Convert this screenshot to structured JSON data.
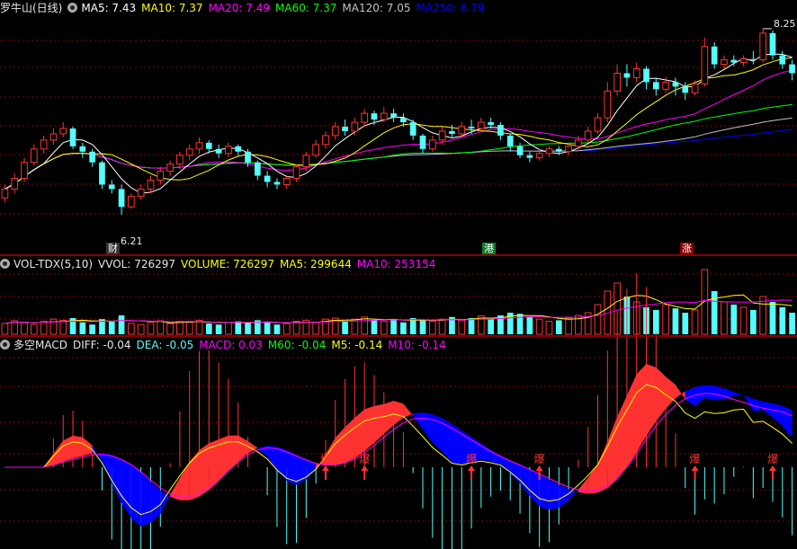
{
  "main_header": {
    "stock_name": "罗牛山(日线)",
    "ma5": "MA5: 7.43",
    "ma10": "MA10: 7.37",
    "ma20": "MA20: 7.49",
    "ma60": "MA60: 7.37",
    "ma120": "MA120: 7.05",
    "ma250": "MA250: 6.79"
  },
  "price_labels": {
    "high": "8.25",
    "low": "6.21"
  },
  "event_tags": {
    "cai": "财",
    "gang": "港",
    "zhang": "涨"
  },
  "volume_header": {
    "indicator": "VOL-TDX(5,10)",
    "vvol": "VVOL: 726297",
    "volume": "VOLUME: 726297",
    "ma5": "MA5: 299644",
    "ma10": "MA10: 253154"
  },
  "macd_header": {
    "indicator": "多空MACD",
    "diff": "DIFF: -0.04",
    "dea": "DEA: -0.05",
    "macd": "MACD: 0.03",
    "m60": "M60: -0.04",
    "m5": "M5: -0.14",
    "m10": "M10: -0.14"
  },
  "signal_label": "爆",
  "colors": {
    "background": "#000000",
    "up": "#ff3232",
    "down": "#54fcfc",
    "ma5": "#ffffff",
    "ma10": "#ffff00",
    "ma20": "#ff00ff",
    "ma60": "#00ff00",
    "ma120": "#c0c0c0",
    "ma250": "#0000ff",
    "grid": "#8b0000"
  },
  "chart_data": {
    "type": "candlestick",
    "price_scale": {
      "min": 6.0,
      "max": 8.4
    },
    "candles": [
      [
        6.4,
        6.5,
        6.35,
        6.55
      ],
      [
        6.5,
        6.62,
        6.45,
        6.68
      ],
      [
        6.62,
        6.8,
        6.58,
        6.85
      ],
      [
        6.8,
        6.95,
        6.76,
        7.0
      ],
      [
        6.95,
        7.05,
        6.9,
        7.1
      ],
      [
        7.05,
        7.12,
        7.0,
        7.18
      ],
      [
        7.12,
        7.18,
        7.08,
        7.25
      ],
      [
        7.18,
        6.98,
        6.95,
        7.2
      ],
      [
        6.98,
        6.92,
        6.85,
        7.02
      ],
      [
        6.92,
        6.8,
        6.75,
        6.95
      ],
      [
        6.8,
        6.55,
        6.5,
        6.82
      ],
      [
        6.55,
        6.5,
        6.45,
        6.6
      ],
      [
        6.5,
        6.3,
        6.21,
        6.55
      ],
      [
        6.3,
        6.42,
        6.28,
        6.45
      ],
      [
        6.42,
        6.5,
        6.38,
        6.55
      ],
      [
        6.5,
        6.6,
        6.45,
        6.65
      ],
      [
        6.6,
        6.7,
        6.55,
        6.75
      ],
      [
        6.7,
        6.78,
        6.65,
        6.82
      ],
      [
        6.78,
        6.88,
        6.72,
        6.92
      ],
      [
        6.88,
        6.95,
        6.82,
        7.0
      ],
      [
        6.95,
        7.02,
        6.9,
        7.08
      ],
      [
        7.02,
        6.95,
        6.9,
        7.05
      ],
      [
        6.95,
        6.9,
        6.85,
        7.0
      ],
      [
        6.9,
        6.98,
        6.86,
        7.02
      ],
      [
        6.98,
        6.92,
        6.88,
        7.0
      ],
      [
        6.92,
        6.8,
        6.75,
        6.95
      ],
      [
        6.8,
        6.65,
        6.6,
        6.82
      ],
      [
        6.65,
        6.58,
        6.52,
        6.7
      ],
      [
        6.58,
        6.55,
        6.5,
        6.62
      ],
      [
        6.55,
        6.62,
        6.5,
        6.65
      ],
      [
        6.62,
        6.75,
        6.58,
        6.78
      ],
      [
        6.75,
        6.88,
        6.7,
        6.92
      ],
      [
        6.88,
        7.0,
        6.85,
        7.05
      ],
      [
        7.0,
        7.1,
        6.95,
        7.15
      ],
      [
        7.1,
        7.2,
        7.05,
        7.25
      ],
      [
        7.2,
        7.15,
        7.1,
        7.28
      ],
      [
        7.15,
        7.25,
        7.1,
        7.3
      ],
      [
        7.25,
        7.35,
        7.2,
        7.4
      ],
      [
        7.35,
        7.28,
        7.22,
        7.38
      ],
      [
        7.28,
        7.35,
        7.25,
        7.42
      ],
      [
        7.35,
        7.3,
        7.25,
        7.4
      ],
      [
        7.3,
        7.25,
        7.2,
        7.35
      ],
      [
        7.25,
        7.1,
        7.05,
        7.28
      ],
      [
        7.1,
        6.95,
        6.9,
        7.12
      ],
      [
        6.95,
        7.05,
        6.92,
        7.1
      ],
      [
        7.05,
        7.15,
        7.0,
        7.2
      ],
      [
        7.15,
        7.12,
        7.08,
        7.22
      ],
      [
        7.12,
        7.2,
        7.08,
        7.25
      ],
      [
        7.2,
        7.18,
        7.12,
        7.28
      ],
      [
        7.18,
        7.25,
        7.15,
        7.3
      ],
      [
        7.25,
        7.22,
        7.18,
        7.3
      ],
      [
        7.22,
        7.1,
        7.05,
        7.25
      ],
      [
        7.1,
        6.98,
        6.92,
        7.12
      ],
      [
        6.98,
        6.88,
        6.85,
        7.02
      ],
      [
        6.88,
        6.85,
        6.8,
        6.92
      ],
      [
        6.85,
        6.9,
        6.82,
        6.95
      ],
      [
        6.9,
        6.95,
        6.86,
        6.98
      ],
      [
        6.95,
        6.92,
        6.88,
        6.98
      ],
      [
        6.92,
        6.98,
        6.88,
        7.02
      ],
      [
        6.98,
        7.05,
        6.95,
        7.1
      ],
      [
        7.05,
        7.15,
        7.02,
        7.2
      ],
      [
        7.15,
        7.3,
        7.12,
        7.35
      ],
      [
        7.3,
        7.6,
        7.25,
        7.7
      ],
      [
        7.6,
        7.8,
        7.55,
        7.9
      ],
      [
        7.8,
        7.75,
        7.65,
        7.9
      ],
      [
        7.75,
        7.85,
        7.7,
        7.92
      ],
      [
        7.85,
        7.7,
        7.62,
        7.88
      ],
      [
        7.7,
        7.62,
        7.55,
        7.75
      ],
      [
        7.62,
        7.7,
        7.58,
        7.76
      ],
      [
        7.7,
        7.65,
        7.55,
        7.75
      ],
      [
        7.65,
        7.58,
        7.5,
        7.7
      ],
      [
        7.58,
        7.68,
        7.55,
        7.72
      ],
      [
        7.68,
        8.1,
        7.65,
        8.2
      ],
      [
        8.1,
        7.9,
        7.85,
        8.15
      ],
      [
        7.9,
        7.95,
        7.85,
        8.0
      ],
      [
        7.95,
        7.92,
        7.88,
        8.0
      ],
      [
        7.92,
        7.96,
        7.88,
        8.0
      ],
      [
        7.96,
        7.95,
        7.9,
        8.05
      ],
      [
        7.95,
        8.25,
        7.92,
        8.3
      ],
      [
        8.25,
        8.0,
        7.95,
        8.28
      ],
      [
        8.0,
        7.9,
        7.85,
        8.05
      ],
      [
        7.9,
        7.8,
        7.72,
        7.95
      ]
    ],
    "volumes": [
      20,
      25,
      22,
      18,
      24,
      28,
      26,
      30,
      22,
      18,
      28,
      24,
      35,
      20,
      18,
      22,
      25,
      20,
      24,
      22,
      26,
      20,
      18,
      22,
      24,
      20,
      26,
      22,
      18,
      20,
      24,
      26,
      22,
      28,
      30,
      25,
      28,
      32,
      26,
      24,
      28,
      22,
      30,
      26,
      24,
      28,
      32,
      26,
      30,
      34,
      28,
      35,
      40,
      38,
      32,
      28,
      24,
      26,
      30,
      35,
      40,
      55,
      80,
      95,
      70,
      60,
      50,
      45,
      55,
      48,
      40,
      45,
      120,
      80,
      60,
      55,
      50,
      45,
      70,
      60,
      50,
      40
    ]
  }
}
